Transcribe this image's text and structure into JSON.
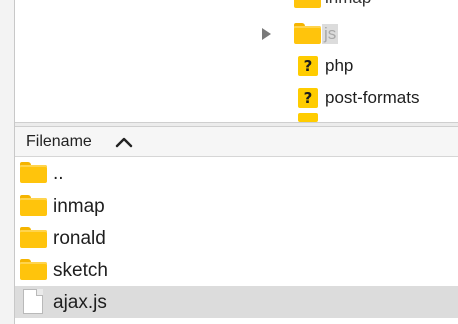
{
  "tree": {
    "items": [
      {
        "label": "inmap",
        "icon": "folder-icon",
        "state": "partial"
      },
      {
        "label": "js",
        "icon": "folder-icon",
        "state": "selected",
        "expander": true
      },
      {
        "label": "php",
        "icon": "unknown-icon",
        "state": "normal"
      },
      {
        "label": "post-formats",
        "icon": "unknown-icon",
        "state": "normal"
      }
    ],
    "unknown_glyph": "?"
  },
  "file_list": {
    "header": {
      "filename": "Filename",
      "sort": "ascending"
    },
    "rows": [
      {
        "name": "..",
        "icon": "folder-icon"
      },
      {
        "name": "inmap",
        "icon": "folder-icon"
      },
      {
        "name": "ronald",
        "icon": "folder-icon"
      },
      {
        "name": "sketch",
        "icon": "folder-icon"
      },
      {
        "name": "ajax.js",
        "icon": "file-icon",
        "selected": true
      }
    ]
  },
  "colors": {
    "folder": "#ffc40c",
    "selection": "#dcdcdc",
    "header_bg": "#f6f6f6"
  }
}
